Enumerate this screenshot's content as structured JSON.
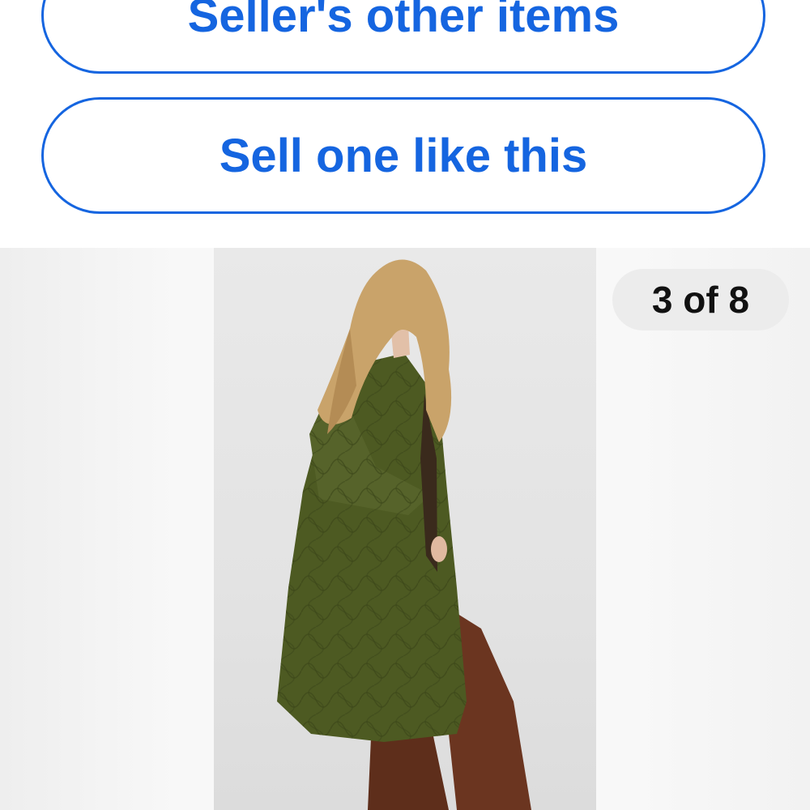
{
  "actions": {
    "sellers_other_items_label": "Seller's other items",
    "sell_one_like_this_label": "Sell one like this"
  },
  "gallery": {
    "counter_text": "3 of 8",
    "image_subject": "model wearing olive green quilted long coat with brown trousers"
  },
  "colors": {
    "accent": "#1565e0",
    "counter_bg": "#ececec",
    "coat": "#4d5a22",
    "trousers": "#6b3520",
    "hair": "#c9a36a"
  }
}
